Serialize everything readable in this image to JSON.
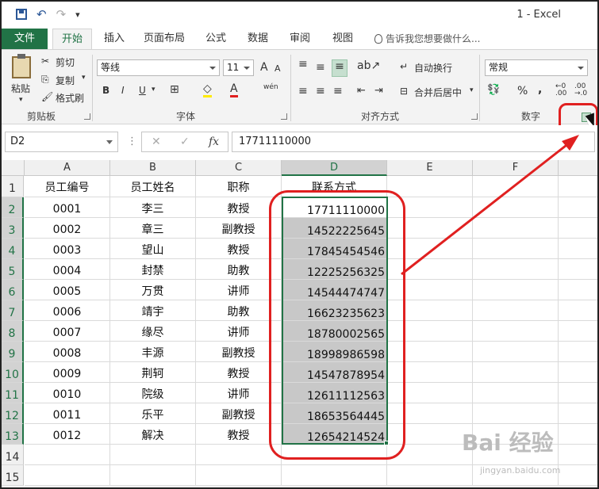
{
  "window": {
    "title": "1 - Excel"
  },
  "qat": {
    "undo": "↶",
    "redo": "↷",
    "customize": "▾"
  },
  "tabs": [
    {
      "label": "文件"
    },
    {
      "label": "开始"
    },
    {
      "label": "插入"
    },
    {
      "label": "页面布局"
    },
    {
      "label": "公式"
    },
    {
      "label": "数据"
    },
    {
      "label": "审阅"
    },
    {
      "label": "视图"
    }
  ],
  "tell_me": "告诉我您想要做什么...",
  "ribbon": {
    "clipboard": {
      "paste": "粘贴",
      "cut": "剪切",
      "copy": "复制",
      "format_painter": "格式刷",
      "label": "剪贴板"
    },
    "font": {
      "name": "等线",
      "size": "11",
      "label": "字体",
      "bold": "B",
      "italic": "I",
      "underline": "U",
      "grow": "A",
      "shrink": "A",
      "font_color": "A",
      "phonetic": "wén"
    },
    "alignment": {
      "wrap": "自动换行",
      "merge": "合并后居中",
      "label": "对齐方式"
    },
    "number": {
      "format": "常规",
      "percent": "%",
      "comma": ",",
      "label": "数字"
    }
  },
  "formula_bar": {
    "name_box": "D2",
    "fx": "fx",
    "value": "17711110000"
  },
  "grid": {
    "columns": [
      "A",
      "B",
      "C",
      "D",
      "E",
      "F"
    ],
    "header_row": [
      "员工编号",
      "员工姓名",
      "职称",
      "联系方式"
    ],
    "rows": [
      [
        "0001",
        "李三",
        "教授",
        "17711110000"
      ],
      [
        "0002",
        "章三",
        "副教授",
        "14522225645"
      ],
      [
        "0003",
        "望山",
        "教授",
        "17845454546"
      ],
      [
        "0004",
        "封禁",
        "助教",
        "12225256325"
      ],
      [
        "0005",
        "万贯",
        "讲师",
        "14544474747"
      ],
      [
        "0006",
        "靖宇",
        "助教",
        "16623235623"
      ],
      [
        "0007",
        "缘尽",
        "讲师",
        "18780002565"
      ],
      [
        "0008",
        "丰源",
        "副教授",
        "18998986598"
      ],
      [
        "0009",
        "荆轲",
        "教授",
        "14547878954"
      ],
      [
        "0010",
        "院级",
        "讲师",
        "12611112563"
      ],
      [
        "0011",
        "乐平",
        "副教授",
        "18653564445"
      ],
      [
        "0012",
        "解决",
        "教授",
        "12654214524"
      ]
    ],
    "row_numbers": [
      "1",
      "2",
      "3",
      "4",
      "5",
      "6",
      "7",
      "8",
      "9",
      "10",
      "11",
      "12",
      "13",
      "14",
      "15"
    ]
  },
  "watermark": {
    "text": "Bai 经验",
    "sub": "jingyan.baidu.com"
  },
  "colors": {
    "accent": "#217346",
    "annotation": "#e02020"
  }
}
